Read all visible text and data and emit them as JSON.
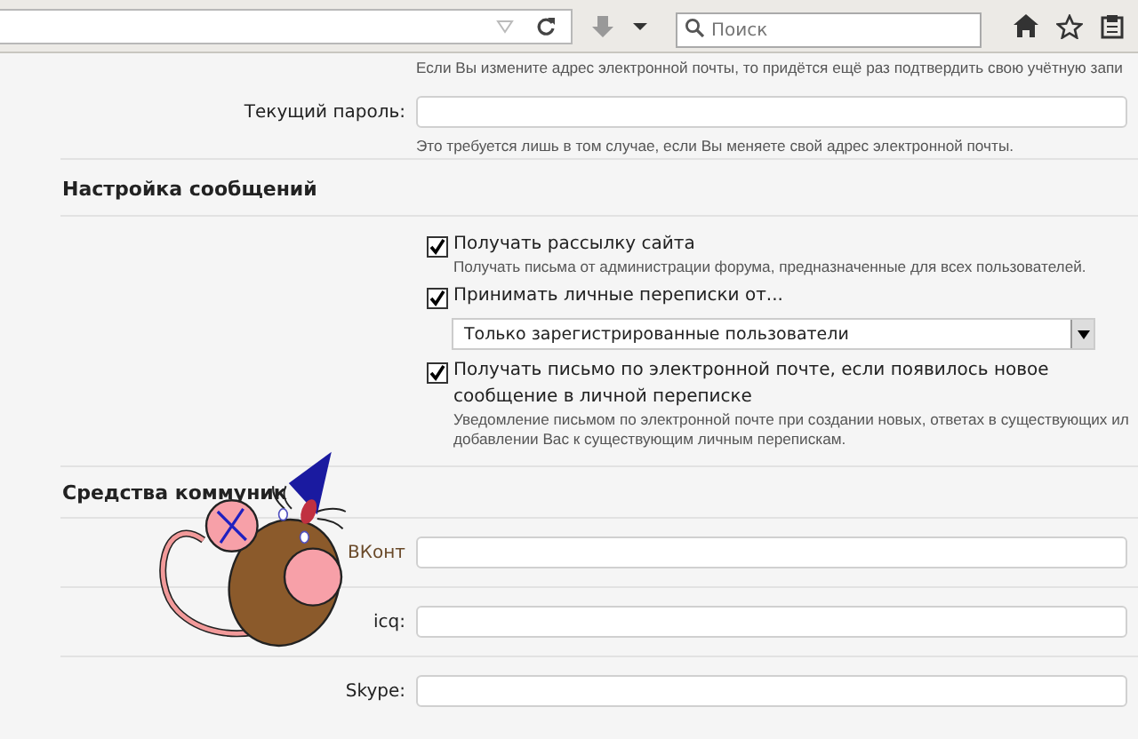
{
  "toolbar": {
    "search": {
      "placeholder": "Поиск"
    }
  },
  "account": {
    "email_hint": "Если Вы измените адрес электронной почты, то придётся ещё раз подтвердить свою учётную запи",
    "password_label": "Текущий пароль:",
    "password_hint": "Это требуется лишь в том случае, если Вы меняете свой адрес электронной почты."
  },
  "messages": {
    "heading": "Настройка сообщений",
    "options": [
      {
        "kind": "checkbox",
        "label": "Получать рассылку сайта",
        "checked": true,
        "description": [
          "Получать письма от администрации форума, предназначенные для всех пользователей."
        ]
      },
      {
        "kind": "checkbox",
        "label": "Принимать личные переписки от...",
        "checked": true
      },
      {
        "kind": "select",
        "value": "Только зарегистрированные пользователи"
      },
      {
        "kind": "checkbox",
        "label": "Получать письмо по электронной почте, если появилось новое сообщение в личной переписке",
        "checked": true,
        "description": [
          "Уведомление письмом по электронной почте при создании новых, ответах в существующих ил",
          "добавлении Вас к существующим личным перепискам."
        ]
      }
    ]
  },
  "communication": {
    "heading": "Средства коммуник",
    "fields": [
      {
        "label": "ВКонт"
      },
      {
        "label": "icq:"
      },
      {
        "label": "Skype:"
      }
    ]
  }
}
